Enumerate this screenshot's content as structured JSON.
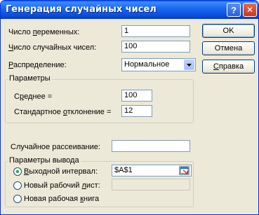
{
  "window": {
    "title": "Генерация случайных чисел"
  },
  "titlebar": {
    "help_glyph": "?",
    "close_glyph": "✕"
  },
  "fields": {
    "num_variables": {
      "label_pre": "Число ",
      "label_u": "п",
      "label_post": "еременных:",
      "value": "1"
    },
    "num_random": {
      "label_pre": "",
      "label_u": "Ч",
      "label_post": "исло случайных чисел:",
      "value": "100"
    },
    "distribution": {
      "label_pre": "",
      "label_u": "Р",
      "label_post": "аспределение:",
      "value": "Нормальное"
    }
  },
  "params": {
    "title": "Параметры",
    "mean": {
      "label_pre": "С",
      "label_u": "р",
      "label_post": "еднее =",
      "value": "100"
    },
    "stddev": {
      "label_pre": "Стандартное ",
      "label_u": "о",
      "label_post": "тклонение =",
      "value": "12"
    }
  },
  "seed": {
    "label_pre": "Случайное рассеивание:",
    "value": ""
  },
  "output": {
    "title": "Параметры вывода",
    "range": {
      "label_pre": "",
      "label_u": "В",
      "label_post": "ыходной интервал:",
      "value": "$A$1",
      "checked": true
    },
    "new_sheet": {
      "label_pre": "Новый рабочий ",
      "label_u": "л",
      "label_post": "ист:",
      "value": "",
      "checked": false
    },
    "new_book": {
      "label_pre": "Новая рабочая ",
      "label_u": "к",
      "label_post": "нига",
      "checked": false
    }
  },
  "buttons": {
    "ok": "OK",
    "cancel": "Отмена",
    "help": {
      "pre": "",
      "u": "С",
      "post": "правка"
    }
  }
}
